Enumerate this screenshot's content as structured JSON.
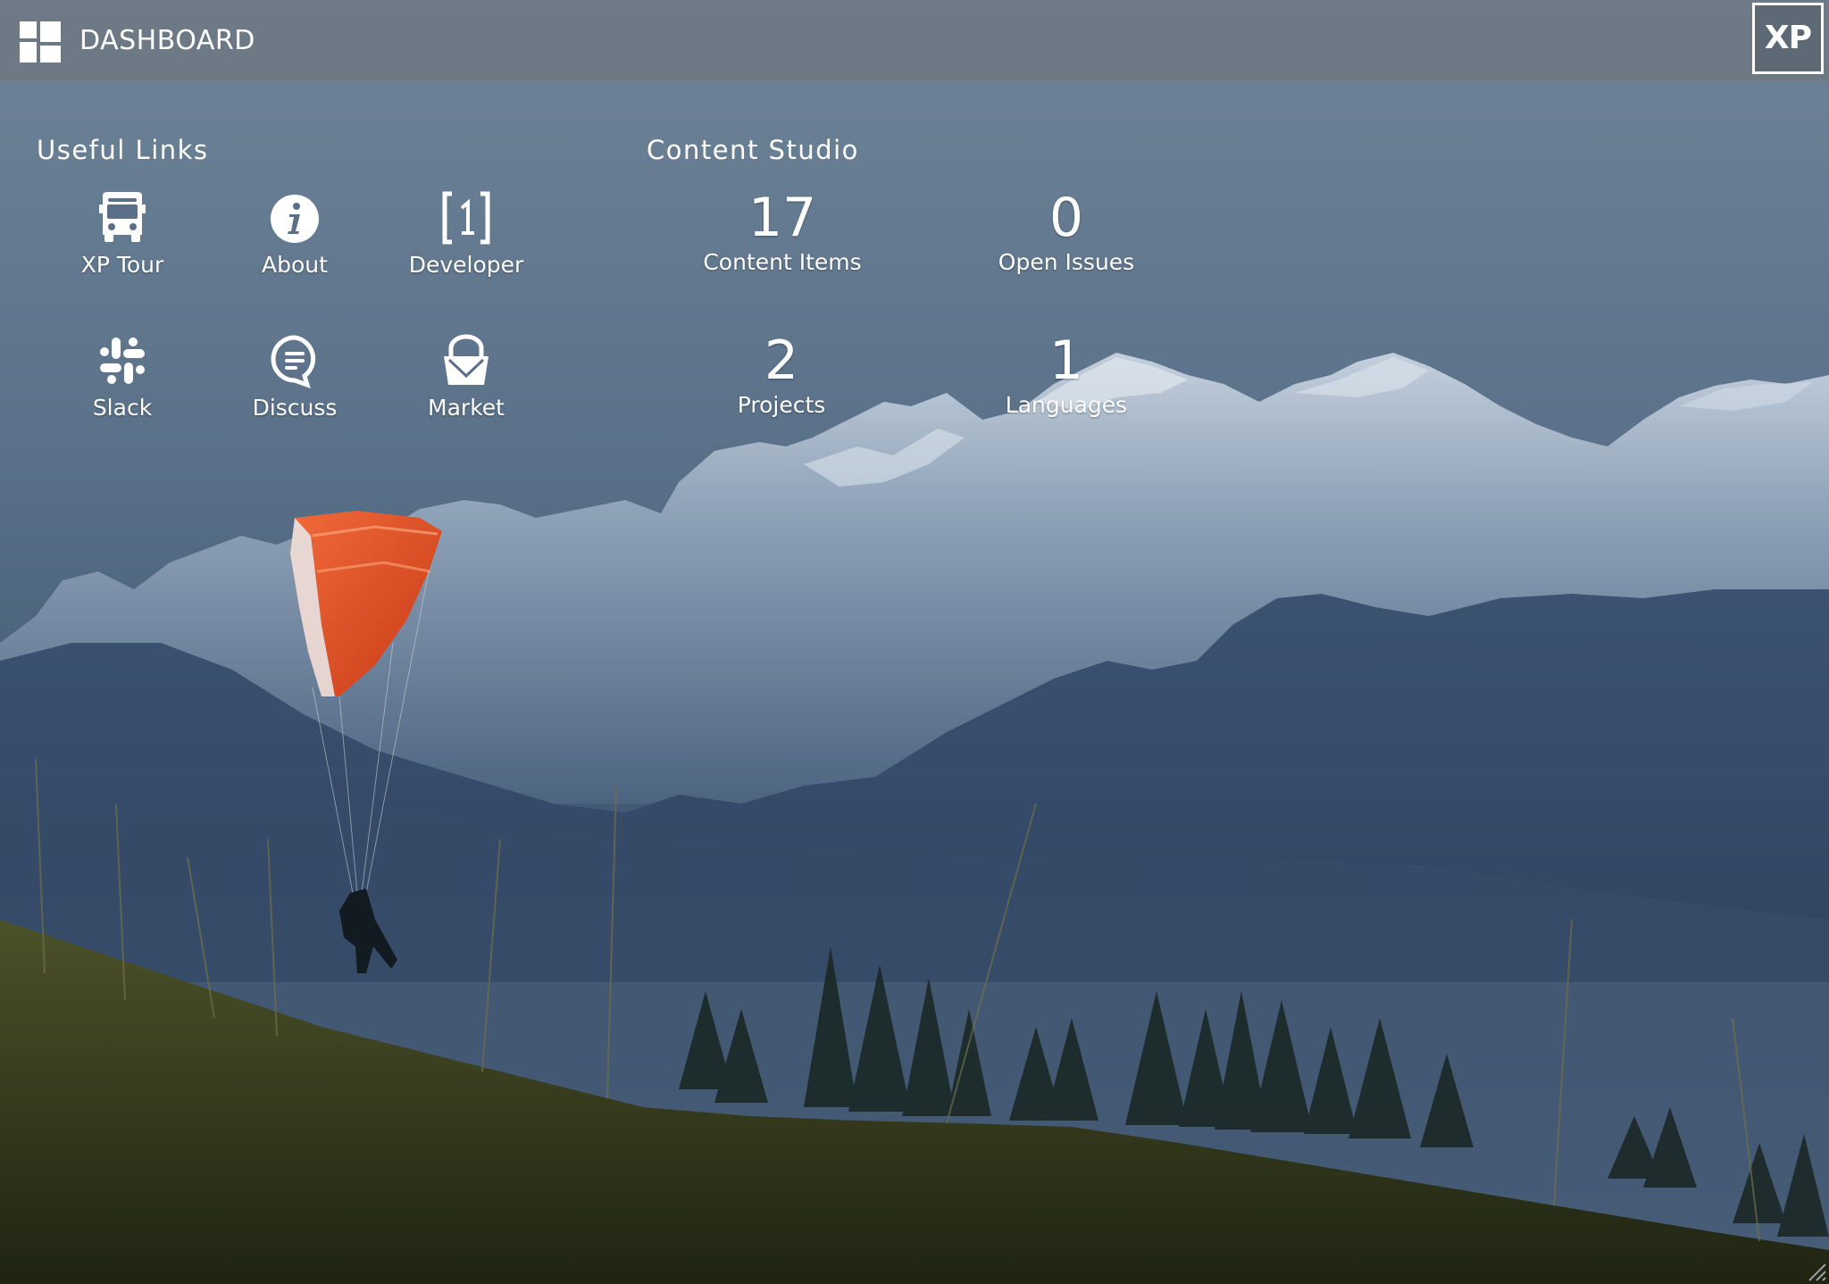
{
  "header": {
    "title": "DASHBOARD",
    "xp_label": "XP"
  },
  "useful_links": {
    "title": "Useful Links",
    "items": [
      {
        "label": "XP Tour",
        "icon": "bus-icon"
      },
      {
        "label": "About",
        "icon": "info-icon"
      },
      {
        "label": "Developer",
        "icon": "developer-bracket-icon"
      },
      {
        "label": "Slack",
        "icon": "slack-icon"
      },
      {
        "label": "Discuss",
        "icon": "chat-bubble-icon"
      },
      {
        "label": "Market",
        "icon": "basket-icon"
      }
    ]
  },
  "content_studio": {
    "title": "Content Studio",
    "stats": [
      {
        "value": "17",
        "label": "Content Items"
      },
      {
        "value": "0",
        "label": "Open Issues"
      },
      {
        "value": "2",
        "label": "Projects"
      },
      {
        "value": "1",
        "label": "Languages"
      }
    ]
  },
  "colors": {
    "topbar": "#6e767e",
    "sky_top": "#6b8298",
    "sky_bottom": "#3f5670",
    "mountain_snow": "#b6c3d2",
    "grass": "#3e4424",
    "paraglider": "#e04a22"
  }
}
